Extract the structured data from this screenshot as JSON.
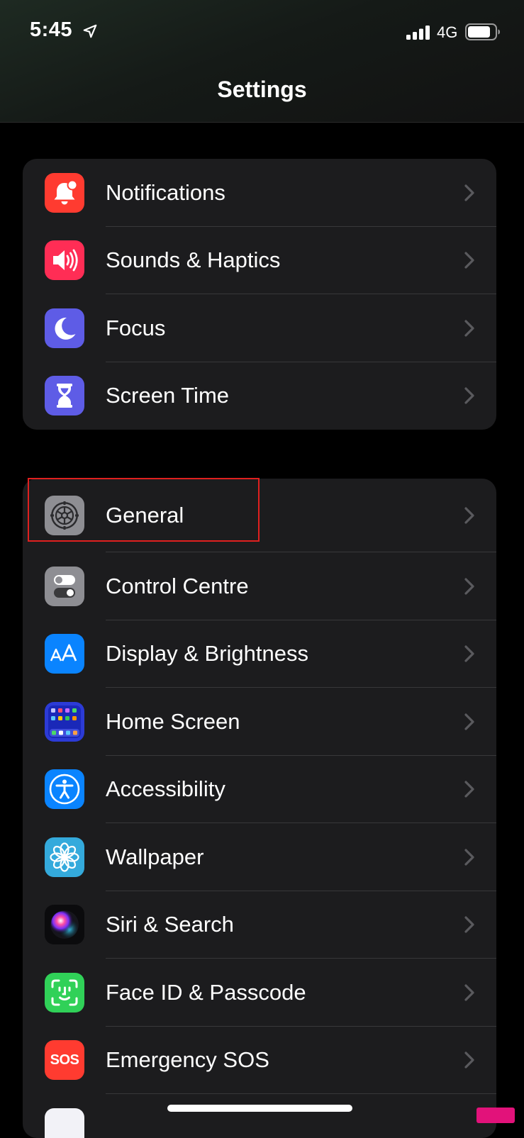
{
  "status_bar": {
    "time": "5:45",
    "network": "4G",
    "icons": [
      "location-arrow-icon",
      "cellular-signal-icon",
      "battery-icon"
    ]
  },
  "nav": {
    "title": "Settings"
  },
  "groups": [
    {
      "items": [
        {
          "label": "Notifications",
          "icon": "notifications-icon",
          "icon_color": "#ff3b30"
        },
        {
          "label": "Sounds & Haptics",
          "icon": "speaker-icon",
          "icon_color": "#ff2d55"
        },
        {
          "label": "Focus",
          "icon": "moon-icon",
          "icon_color": "#5e5ce6"
        },
        {
          "label": "Screen Time",
          "icon": "hourglass-icon",
          "icon_color": "#5e5ce6"
        }
      ]
    },
    {
      "items": [
        {
          "label": "General",
          "icon": "gear-icon",
          "icon_color": "#8e8e93",
          "highlighted": true
        },
        {
          "label": "Control Centre",
          "icon": "toggles-icon",
          "icon_color": "#8e8e93"
        },
        {
          "label": "Display & Brightness",
          "icon": "text-size-icon",
          "icon_color": "#0a84ff"
        },
        {
          "label": "Home Screen",
          "icon": "app-grid-icon",
          "icon_color": "#2c3bd6"
        },
        {
          "label": "Accessibility",
          "icon": "accessibility-icon",
          "icon_color": "#0a84ff"
        },
        {
          "label": "Wallpaper",
          "icon": "flower-icon",
          "icon_color": "#34aadc"
        },
        {
          "label": "Siri & Search",
          "icon": "siri-icon",
          "icon_color": "#000000"
        },
        {
          "label": "Face ID & Passcode",
          "icon": "face-id-icon",
          "icon_color": "#30d158"
        },
        {
          "label": "Emergency SOS",
          "icon": "sos-icon",
          "icon_color": "#ff3b30",
          "icon_text": "SOS"
        }
      ]
    }
  ],
  "highlight_color": "#e0201f"
}
